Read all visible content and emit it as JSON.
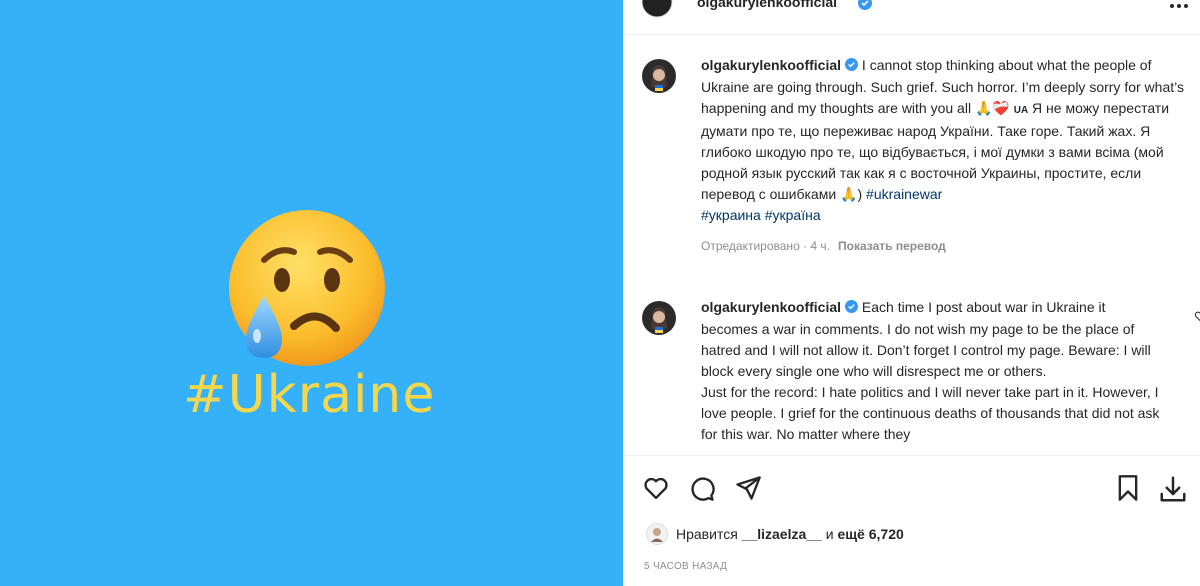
{
  "media": {
    "hashtag": "#Ukraine",
    "emoji_icon": "crying-face-icon",
    "background_color": "#35b1f9",
    "hashtag_color": "#f6d64a"
  },
  "header": {
    "username": "olgakurylenkoofficial",
    "verified_icon": "verified-badge-icon",
    "more_icon": "more-dots-icon"
  },
  "caption": {
    "username": "olgakurylenkoofficial",
    "text_en": " I cannot stop thinking about what the people of Ukraine are going through. Such grief. Such horror. I’m deeply sorry for what’s happening and my thoughts are with you all 🙏❤️‍🩹 ",
    "ua_label": "UA",
    "text_ua": " Я не можу перестати думати про те, що переживає народ України. Таке горе. Такий жах. Я глибоко шкодую про те, що відбувається, і мої думки з вами всіма (мой родной язык русский так как я с восточной Украины, простите, если перевод с ошибками 🙏) ",
    "tag1": "#ukrainewar",
    "tag2": "#украина",
    "tag3": "#україна",
    "edited": "Отредактировано · 4 ч.",
    "translate": "Показать перевод"
  },
  "comment2": {
    "username": "olgakurylenkoofficial",
    "text1": " Each time I post about war in Ukraine it becomes a war in comments. I do not wish my page to be the place of hatred and I will not allow it. Don’t forget I control my page. Beware: I will block every single one who will disrespect me or others.",
    "text2": "Just for the record: I hate politics and I will never take part in it. However, I love people. I grief for the continuous deaths of thousands that did not ask for this war. No matter where they"
  },
  "actions": {
    "like_icon": "heart-icon",
    "comment_icon": "comment-bubble-icon",
    "share_icon": "paper-plane-icon",
    "save_icon": "bookmark-icon",
    "download_icon": "download-icon"
  },
  "likes": {
    "prefix": "Нравится ",
    "user": "__lizaelza__",
    "middle": " и ",
    "count": "ещё 6,720"
  },
  "timeago": "5 часов назад"
}
